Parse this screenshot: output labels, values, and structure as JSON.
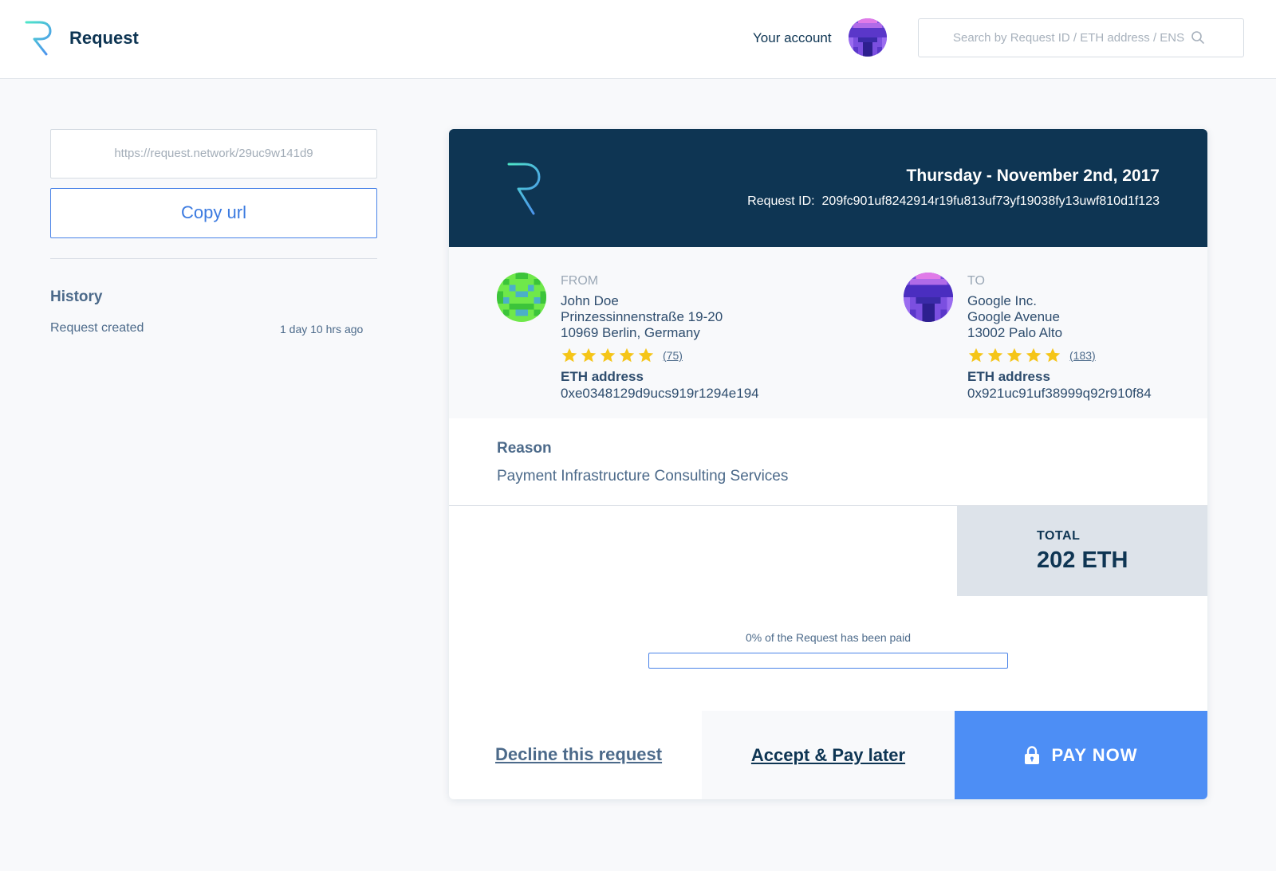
{
  "header": {
    "brand": "Request",
    "account_label": "Your account",
    "search_placeholder": "Search by Request ID / ETH address / ENS"
  },
  "share": {
    "url": "https://request.network/29uc9w141d9",
    "copy_label": "Copy url"
  },
  "history": {
    "title": "History",
    "items": [
      {
        "label": "Request created",
        "time": "1 day 10 hrs ago"
      }
    ]
  },
  "request": {
    "date": "Thursday - November 2nd, 2017",
    "id_label": "Request ID:",
    "id_value": "209fc901uf8242914r19fu813uf73yf19038fy13uwf810d1f123",
    "from": {
      "label": "FROM",
      "name": "John Doe",
      "address_line1": "Prinzessinnenstraße 19-20",
      "address_line2": "10969 Berlin, Germany",
      "rating_stars": 5,
      "rating_count": "(75)",
      "eth_label": "ETH address",
      "eth_address": "0xe0348129d9ucs919r1294e194"
    },
    "to": {
      "label": "TO",
      "name": "Google Inc.",
      "address_line1": "Google Avenue",
      "address_line2": "13002 Palo Alto",
      "rating_stars": 5,
      "rating_count": "(183)",
      "eth_label": "ETH address",
      "eth_address": "0x921uc91uf38999q92r910f84"
    },
    "reason_title": "Reason",
    "reason_text": "Payment Infrastructure Consulting Services",
    "total_label": "TOTAL",
    "total_value": "202 ETH",
    "paid_text": "0% of the Request has been paid",
    "paid_fraction": 0
  },
  "actions": {
    "decline": "Decline this request",
    "accept": "Accept & Pay later",
    "pay": "PAY NOW"
  },
  "colors": {
    "navy": "#0e3553",
    "accent": "#4d8ef5",
    "star": "#f5c518"
  }
}
